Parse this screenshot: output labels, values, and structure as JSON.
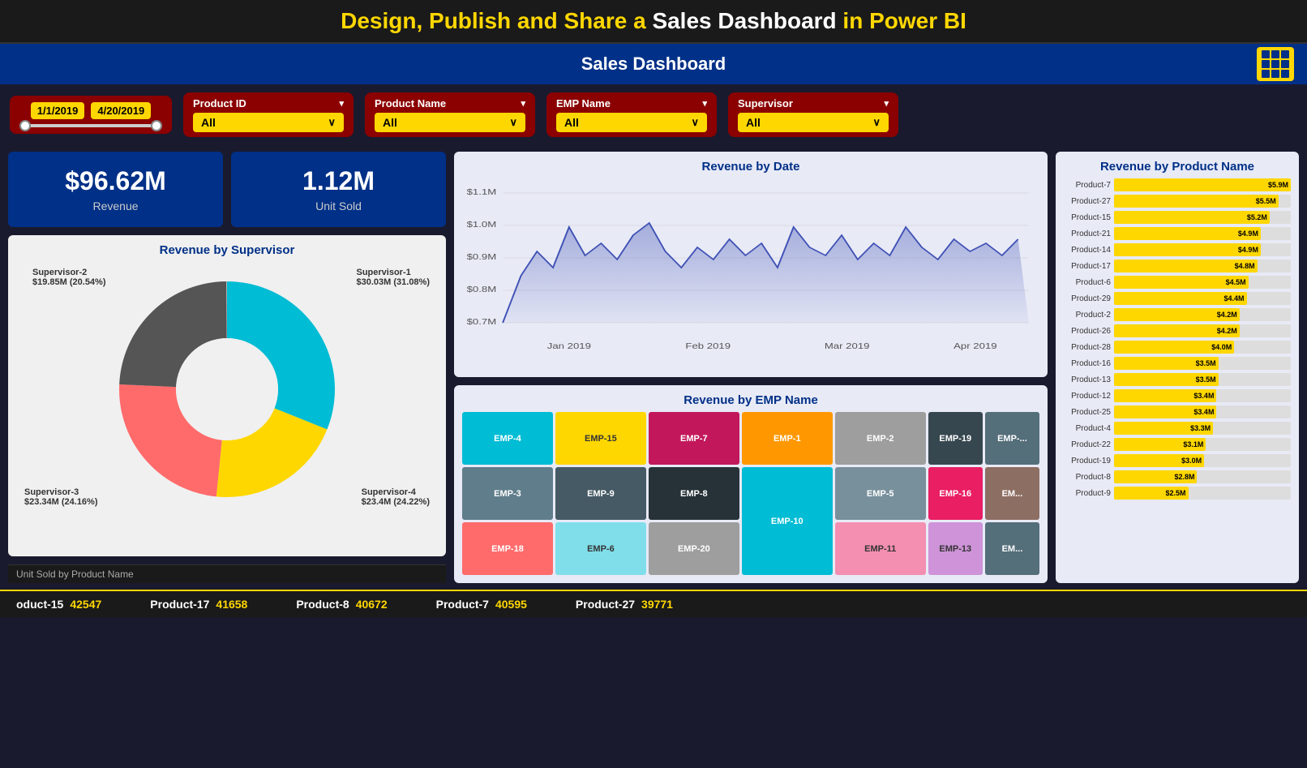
{
  "topBanner": {
    "title_start": "Design, Publish and Share a ",
    "title_highlight": "Sales Dashboard",
    "title_end": " in Power BI"
  },
  "subHeader": {
    "title": "Sales Dashboard"
  },
  "filters": {
    "dateStart": "1/1/2019",
    "dateEnd": "4/20/2019",
    "productId": {
      "label": "Product ID",
      "value": "All"
    },
    "productName": {
      "label": "Product Name",
      "value": "All"
    },
    "empName": {
      "label": "EMP Name",
      "value": "All"
    },
    "supervisor": {
      "label": "Supervisor",
      "value": "All"
    }
  },
  "kpi": {
    "revenue": {
      "value": "$96.62M",
      "label": "Revenue"
    },
    "units": {
      "value": "1.12M",
      "label": "Unit Sold"
    }
  },
  "revenueByDate": {
    "title": "Revenue by Date",
    "xLabels": [
      "Jan 2019",
      "Feb 2019",
      "Mar 2019",
      "Apr 2019"
    ],
    "yLabels": [
      "$0.7M",
      "$0.8M",
      "$0.9M",
      "$1.0M",
      "$1.1M"
    ]
  },
  "revenueByProduct": {
    "title": "Revenue by Product Name",
    "items": [
      {
        "name": "Product-7",
        "value": "$5.9M",
        "pct": 100
      },
      {
        "name": "Product-27",
        "value": "$5.5M",
        "pct": 93
      },
      {
        "name": "Product-15",
        "value": "$5.2M",
        "pct": 88
      },
      {
        "name": "Product-21",
        "value": "$4.9M",
        "pct": 83
      },
      {
        "name": "Product-14",
        "value": "$4.9M",
        "pct": 83
      },
      {
        "name": "Product-17",
        "value": "$4.8M",
        "pct": 81
      },
      {
        "name": "Product-6",
        "value": "$4.5M",
        "pct": 76
      },
      {
        "name": "Product-29",
        "value": "$4.4M",
        "pct": 75
      },
      {
        "name": "Product-2",
        "value": "$4.2M",
        "pct": 71
      },
      {
        "name": "Product-26",
        "value": "$4.2M",
        "pct": 71
      },
      {
        "name": "Product-28",
        "value": "$4.0M",
        "pct": 68
      },
      {
        "name": "Product-16",
        "value": "$3.5M",
        "pct": 59
      },
      {
        "name": "Product-13",
        "value": "$3.5M",
        "pct": 59
      },
      {
        "name": "Product-12",
        "value": "$3.4M",
        "pct": 58
      },
      {
        "name": "Product-25",
        "value": "$3.4M",
        "pct": 58
      },
      {
        "name": "Product-4",
        "value": "$3.3M",
        "pct": 56
      },
      {
        "name": "Product-22",
        "value": "$3.1M",
        "pct": 52
      },
      {
        "name": "Product-19",
        "value": "$3.0M",
        "pct": 51
      },
      {
        "name": "Product-8",
        "value": "$2.8M",
        "pct": 47
      },
      {
        "name": "Product-9",
        "value": "$2.5M",
        "pct": 42
      }
    ]
  },
  "revenueBySupervisor": {
    "title": "Revenue by Supervisor",
    "segments": [
      {
        "name": "Supervisor-1",
        "value": "$30.03M (31.08%)",
        "color": "#00BCD4",
        "pct": 31.08
      },
      {
        "name": "Supervisor-2",
        "value": "$19.85M (20.54%)",
        "color": "#FFD700",
        "pct": 20.54
      },
      {
        "name": "Supervisor-3",
        "value": "$23.34M (24.16%)",
        "color": "#FF6B6B",
        "pct": 24.16
      },
      {
        "name": "Supervisor-4",
        "value": "$23.4M (24.22%)",
        "color": "#555",
        "pct": 24.22
      }
    ]
  },
  "revenueByEmp": {
    "title": "Revenue by EMP Name",
    "cells": [
      {
        "label": "EMP-4",
        "color": "#00BCD4",
        "col": 1,
        "row": 1,
        "colspan": 1,
        "rowspan": 1
      },
      {
        "label": "EMP-15",
        "color": "#FFD700",
        "col": 2,
        "row": 1,
        "colspan": 1,
        "rowspan": 1
      },
      {
        "label": "EMP-7",
        "color": "#E91E63",
        "col": 3,
        "row": 1,
        "colspan": 1,
        "rowspan": 1
      },
      {
        "label": "EMP-1",
        "color": "#FF9800",
        "col": 4,
        "row": 1,
        "colspan": 1,
        "rowspan": 1
      },
      {
        "label": "EMP-2",
        "color": "#9E9E9E",
        "col": 5,
        "row": 1,
        "colspan": 1,
        "rowspan": 1
      },
      {
        "label": "EMP-19",
        "color": "#37474F",
        "col": 6,
        "row": 1,
        "colspan": 1,
        "rowspan": 1
      },
      {
        "label": "EMP-...",
        "color": "#546E7A",
        "col": 7,
        "row": 1,
        "colspan": 1,
        "rowspan": 1
      },
      {
        "label": "EMP-3",
        "color": "#607D8B",
        "col": 1,
        "row": 2,
        "colspan": 1,
        "rowspan": 1
      },
      {
        "label": "EMP-9",
        "color": "#455A64",
        "col": 2,
        "row": 2,
        "colspan": 1,
        "rowspan": 1
      },
      {
        "label": "EMP-8",
        "color": "#37474F",
        "col": 3,
        "row": 2,
        "colspan": 1,
        "rowspan": 1
      },
      {
        "label": "EMP-10",
        "color": "#00BCD4",
        "col": 4,
        "row": 2,
        "colspan": 1,
        "rowspan": 2
      },
      {
        "label": "EMP-5",
        "color": "#78909C",
        "col": 4,
        "row": 3,
        "colspan": 1,
        "rowspan": 1
      },
      {
        "label": "EMP-16",
        "color": "#E91E63",
        "col": 5,
        "row": 3,
        "colspan": 1,
        "rowspan": 1
      },
      {
        "label": "EM...",
        "color": "#8D6E63",
        "col": 6,
        "row": 3,
        "colspan": 1,
        "rowspan": 1
      },
      {
        "label": "EM...",
        "color": "#6D4C41",
        "col": 7,
        "row": 3,
        "colspan": 1,
        "rowspan": 1
      },
      {
        "label": "EMP-18",
        "color": "#FF6B6B",
        "col": 1,
        "row": 3,
        "colspan": 1,
        "rowspan": 1
      },
      {
        "label": "EMP-6",
        "color": "#80DEEA",
        "col": 2,
        "row": 3,
        "colspan": 1,
        "rowspan": 1
      },
      {
        "label": "EMP-20",
        "color": "#9E9E9E",
        "col": 3,
        "row": 3,
        "colspan": 1,
        "rowspan": 1
      },
      {
        "label": "EMP-11",
        "color": "#F48FB1",
        "col": 4,
        "row": 4,
        "colspan": 1,
        "rowspan": 1
      },
      {
        "label": "EMP-13",
        "color": "#CE93D8",
        "col": 5,
        "row": 4,
        "colspan": 1,
        "rowspan": 1
      }
    ]
  },
  "ticker": {
    "unitSoldLabel": "Unit Sold by Product Name",
    "items": [
      {
        "product": "oduct-15",
        "value": "42547"
      },
      {
        "product": "Product-17",
        "value": "41658"
      },
      {
        "product": "Product-8",
        "value": "40672"
      },
      {
        "product": "Product-7",
        "value": "40595"
      },
      {
        "product": "Product-27",
        "value": "39771"
      }
    ]
  }
}
